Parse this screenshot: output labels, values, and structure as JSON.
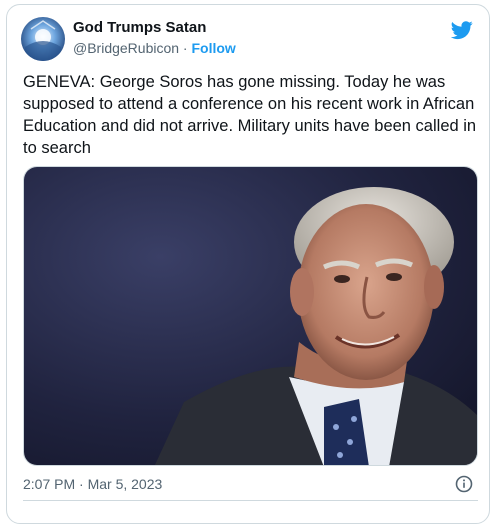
{
  "author": {
    "display_name": "God Trumps Satan",
    "handle": "@BridgeRubicon",
    "separator": " · ",
    "follow_label": "Follow"
  },
  "tweet": {
    "text": "GENEVA: George Soros has gone missing. Today he was supposed to attend a conference on his recent work in African Education and did not arrive. Military units have been called in to search",
    "timestamp": "2:07 PM · Mar 5, 2023"
  },
  "icons": {
    "brand": "twitter-bird-icon",
    "info": "info-icon"
  },
  "colors": {
    "accent": "#1d9bf0",
    "secondary_text": "#536471",
    "border": "#cfd9de"
  }
}
